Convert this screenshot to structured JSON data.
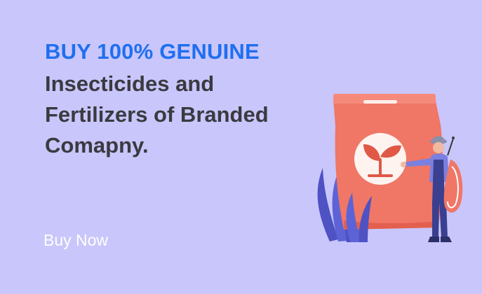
{
  "banner": {
    "accent_line": "BUY 100% GENUINE",
    "headline_lines": [
      "Insecticides and",
      "Fertilizers of Branded",
      "Comapny."
    ],
    "cta_label": "Buy Now"
  },
  "colors": {
    "background": "#c9c6fb",
    "accent": "#1f6ff0",
    "headline": "#3a3a40",
    "cta": "#ffffff",
    "bag": "#f07666",
    "plants": "#5d63d6"
  },
  "icons": [
    "fertilizer-bag-icon",
    "sprout-icon",
    "farmer-with-sprayer-icon",
    "plant-leaves-icon"
  ]
}
